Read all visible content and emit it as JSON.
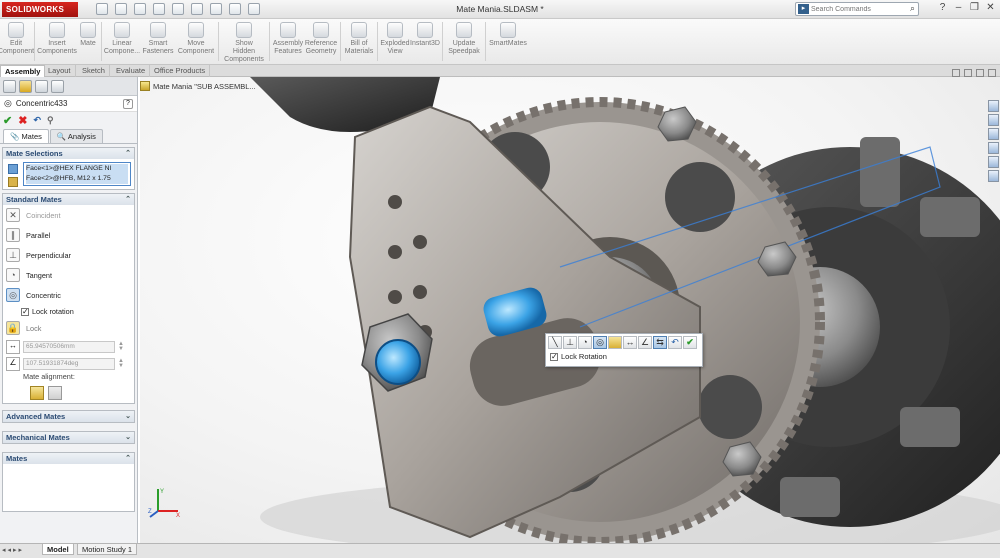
{
  "app": {
    "brand": "SOLIDWORKS",
    "document_title": "Mate Mania.SLDASM *"
  },
  "search": {
    "placeholder": "Search Commands"
  },
  "ribbon": {
    "buttons": [
      {
        "label": "Edit\nComponent"
      },
      {
        "label": "Insert\nComponents"
      },
      {
        "label": "Mate"
      },
      {
        "label": "Linear\nCompone..."
      },
      {
        "label": "Smart\nFasteners"
      },
      {
        "label": "Move\nComponent"
      },
      {
        "label": "Show\nHidden\nComponents"
      },
      {
        "label": "Assembly\nFeatures"
      },
      {
        "label": "Reference\nGeometry"
      },
      {
        "label": "Bill of\nMaterials"
      },
      {
        "label": "Exploded\nView"
      },
      {
        "label": "Instant3D"
      },
      {
        "label": "Update\nSpeedpak"
      },
      {
        "label": "SmartMates"
      }
    ]
  },
  "command_tabs": [
    "Assembly",
    "Layout",
    "Sketch",
    "Evaluate",
    "Office Products"
  ],
  "tree_flyout": {
    "label": "Mate Mania \"SUB ASSEMBL..."
  },
  "property_manager": {
    "title": "Concentric433",
    "tabs": [
      "Mates",
      "Analysis"
    ],
    "mate_selections": {
      "header": "Mate Selections",
      "items": [
        "Face<1>@HEX FLANGE NI",
        "Face<2>@HFB, M12 x 1.75"
      ]
    },
    "standard_mates": {
      "header": "Standard Mates",
      "items": [
        {
          "label": "Coincident",
          "icon": "coincident-icon",
          "dim": true
        },
        {
          "label": "Parallel",
          "icon": "parallel-icon"
        },
        {
          "label": "Perpendicular",
          "icon": "perpendicular-icon"
        },
        {
          "label": "Tangent",
          "icon": "tangent-icon"
        },
        {
          "label": "Concentric",
          "icon": "concentric-icon",
          "active": true
        }
      ],
      "lock_rotation_label": "Lock rotation",
      "lock_label": "Lock",
      "distance_value": "65.94570506mm",
      "angle_value": "107.51931874deg",
      "alignment_label": "Mate alignment:"
    },
    "collapsed_groups": [
      "Advanced Mates",
      "Mechanical Mates"
    ],
    "mates_group": "Mates"
  },
  "context_toolbar": {
    "lock_rotation_label": "Lock Rotation"
  },
  "bottom_tabs": [
    "Model",
    "Motion Study 1"
  ],
  "colors": {
    "brand_red": "#c41e17",
    "selection_blue": "#4e86c7",
    "accent_green": "#2c9b2c"
  }
}
